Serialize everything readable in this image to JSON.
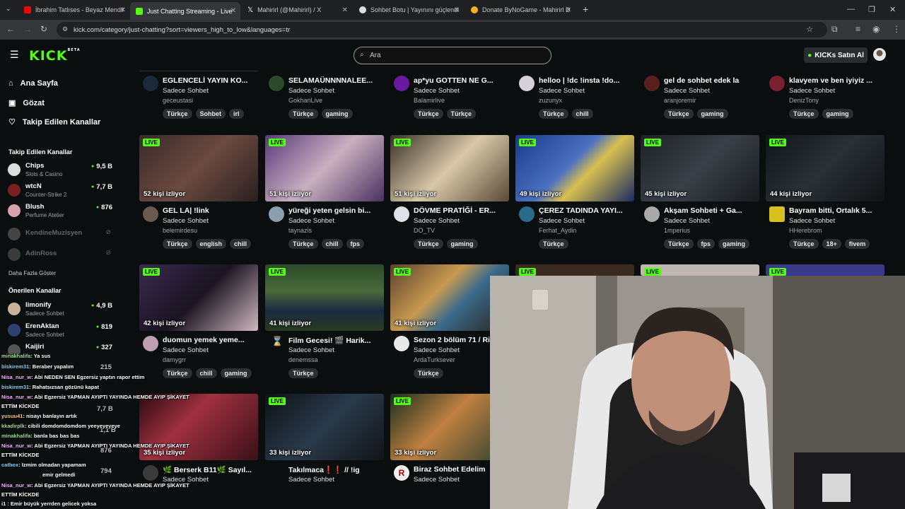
{
  "browser": {
    "tabs": [
      {
        "title": "İbrahim Tatlıses - Beyaz Mendil",
        "icon": "youtube-icon",
        "color": "#ff0000"
      },
      {
        "title": "Just Chatting Streaming - Live",
        "icon": "kick-icon",
        "color": "#53fc18"
      },
      {
        "title": "Mahirirl (@Mahirirl) / X",
        "icon": "x-icon",
        "color": "#ffffff"
      },
      {
        "title": "Sohbet Botu | Yayınını güçlendi",
        "icon": "bot-icon",
        "color": "#dddddd"
      },
      {
        "title": "Donate ByNoGame - Mahirirl D",
        "icon": "donate-icon",
        "color": "#ffb020"
      }
    ],
    "new_tab": "+",
    "url": "kick.com/category/just-chatting?sort=viewers_high_to_low&languages=tr"
  },
  "header": {
    "logo": "KICK",
    "logo_badge": "BETA",
    "search_placeholder": "Ara",
    "kicks_button": "KICKs Satın Al",
    "accent": "#53fc18"
  },
  "sidebar": {
    "nav": [
      {
        "label": "Ana Sayfa",
        "icon": "home-icon"
      },
      {
        "label": "Gözat",
        "icon": "browse-icon"
      },
      {
        "label": "Takip Edilen Kanallar",
        "icon": "heart-icon"
      }
    ],
    "followed_title": "Takip Edilen Kanallar",
    "followed": [
      {
        "name": "Chips",
        "category": "Slots & Casino",
        "viewers": "9,5 B",
        "online": true
      },
      {
        "name": "wtcN",
        "category": "Counter-Strike 2",
        "viewers": "7,7 B",
        "online": true
      },
      {
        "name": "Blush",
        "category": "Perfume Atelier",
        "viewers": "876",
        "online": true
      },
      {
        "name": "KendineMuzisyen",
        "category": "",
        "viewers": "",
        "online": false
      },
      {
        "name": "AdinRoss",
        "category": "",
        "viewers": "",
        "online": false
      }
    ],
    "show_more": "Daha Fazla Göster",
    "recommended_title": "Önerilen Kanallar",
    "recommended": [
      {
        "name": "limonify",
        "category": "Sadece Sohbet",
        "viewers": "4,9 B"
      },
      {
        "name": "ErenAktan",
        "category": "Sadece Sohbet",
        "viewers": "819"
      },
      {
        "name": "Kaijiri",
        "category": "",
        "viewers": "327"
      }
    ],
    "faded_viewers": [
      "215",
      "7,7 B",
      "1,1 B",
      "876",
      "794"
    ]
  },
  "grid": {
    "live_label": "LIVE",
    "row0": [
      {
        "title": "EGLENCELİ YAYIN KO...",
        "category": "Sadece Sohbet",
        "user": "geceustasi",
        "tags": [
          "Türkçe",
          "Sohbet",
          "irl"
        ]
      },
      {
        "title": "SELAMAÜNNNNALEE...",
        "category": "Sadece Sohbet",
        "user": "GokhanLive",
        "tags": [
          "Türkçe",
          "gaming"
        ]
      },
      {
        "title": "ap*yu GOTTEN NE G...",
        "category": "Sadece Sohbet",
        "user": "Balamirlive",
        "tags": [
          "Türkçe",
          "Türkçe"
        ]
      },
      {
        "title": "helloo | !dc !insta !do...",
        "category": "Sadece Sohbet",
        "user": "zuzunyx",
        "tags": [
          "Türkçe",
          "chill"
        ]
      },
      {
        "title": "gel de sohbet edek la",
        "category": "Sadece Sohbet",
        "user": "aranjoremir",
        "tags": [
          "Türkçe",
          "gaming"
        ]
      },
      {
        "title": "klavyem ve ben iyiyiz ...",
        "category": "Sadece Sohbet",
        "user": "DenizTony",
        "tags": [
          "Türkçe",
          "gaming"
        ]
      }
    ],
    "row1": [
      {
        "viewers": "52 kişi izliyor",
        "title": "GEL LA| !link",
        "category": "Sadece Sohbet",
        "user": "belemirdesu",
        "tags": [
          "Türkçe",
          "english",
          "chill"
        ]
      },
      {
        "viewers": "51 kişi izliyor",
        "title": "yüreği yeten gelsin bi...",
        "category": "Sadece Sohbet",
        "user": "taynazis",
        "tags": [
          "Türkçe",
          "chill",
          "fps"
        ]
      },
      {
        "viewers": "51 kişi izliyor",
        "title": "DÖVME PRATİĞİ - ER...",
        "category": "Sadece Sohbet",
        "user": "DO_TV",
        "tags": [
          "Türkçe",
          "gaming"
        ]
      },
      {
        "viewers": "49 kişi izliyor",
        "title": "ÇEREZ TADINDA YAYI...",
        "category": "Sadece Sohbet",
        "user": "Ferhat_Aydin",
        "tags": [
          "Türkçe"
        ]
      },
      {
        "viewers": "45 kişi izliyor",
        "title": "Akşam Sohbeti + Ga...",
        "category": "Sadece Sohbet",
        "user": "1mperius",
        "tags": [
          "Türkçe",
          "fps",
          "gaming"
        ]
      },
      {
        "viewers": "44 kişi izliyor",
        "title": "Bayram bitti, Ortalık 5...",
        "category": "Sadece Sohbet",
        "user": "HHerebrom",
        "tags": [
          "Türkçe",
          "18+",
          "fivem"
        ]
      }
    ],
    "row2": [
      {
        "viewers": "42 kişi izliyor",
        "title": "duomun yemek yeme...",
        "category": "Sadece Sohbet",
        "user": "damygrr",
        "tags": [
          "Türkçe",
          "chill",
          "gaming"
        ]
      },
      {
        "viewers": "41 kişi izliyor",
        "title": "Film Gecesi! 🎬 Harik...",
        "category": "Sadece Sohbet",
        "user": "denemssa",
        "tags": [
          "Türkçe"
        ]
      },
      {
        "viewers": "41 kişi izliyor",
        "title": "Sezon 2 bölüm 71 / Ri",
        "category": "Sadece Sohbet",
        "user": "ArdaTurksever",
        "tags": [
          "Türkçe"
        ]
      }
    ],
    "row3": [
      {
        "viewers": "35 kişi izliyor",
        "title": "🌿 Berserk B11🌿 Sayıl...",
        "category": "Sadece Sohbet",
        "user": ""
      },
      {
        "viewers": "33 kişi izliyor",
        "title": "Takılmaca❗❗ // !ig",
        "category": "Sadece Sohbet",
        "user": ""
      },
      {
        "viewers": "33 kişi izliyor",
        "title": "Biraz Sohbet Edelim",
        "category": "Sadece Sohbet",
        "user": ""
      }
    ]
  },
  "chat": [
    {
      "user": "minakhalifa",
      "text": ": Ya sus"
    },
    {
      "user": "biskirem31",
      "text": ": Beraber yapalım"
    },
    {
      "user": "Nisa_nur_w",
      "text": ": Abi NEDEN SEN Egzersiz yaptın rapor ettim"
    },
    {
      "user": "biskirem31",
      "text": ": Rahatsızsan gözünü kapat"
    },
    {
      "user": "Nisa_nur_w",
      "text": ": Abi Egzersiz YAPMAN AYIPTI YAYINDA HEMDE AYIP ŞİKAYET"
    },
    {
      "user": "",
      "text": "ETTİM KİCKDE"
    },
    {
      "user": "yusuu41",
      "text": ": nisayı banlayın artık"
    },
    {
      "user": "kkadirplk",
      "text": ": cibili domdomdomdom yeeyeyeyeye"
    },
    {
      "user": "minakhalifa",
      "text": ": banla bas bas bas"
    },
    {
      "user": "Nisa_nur_w",
      "text": ": Abi Egzersiz YAPMAN AYIPTI YAYINDA HEMDE AYIP ŞİKAYET"
    },
    {
      "user": "",
      "text": "ETTİM KİCKDE"
    },
    {
      "user": "catbox",
      "text": ": Izmim olmadan yapamam"
    },
    {
      "user": "",
      "text": "emir gelmedi"
    },
    {
      "user": "Nisa_nur_w",
      "text": ": Abi Egzersiz YAPMAN AYIPTI YAYINDA HEMDE AYIP ŞİKAYET"
    },
    {
      "user": "",
      "text": "ETTİM KİCKDE"
    },
    {
      "user": "",
      "text": "i1 : Emir büyük yerrden gelicek yoksa"
    }
  ]
}
